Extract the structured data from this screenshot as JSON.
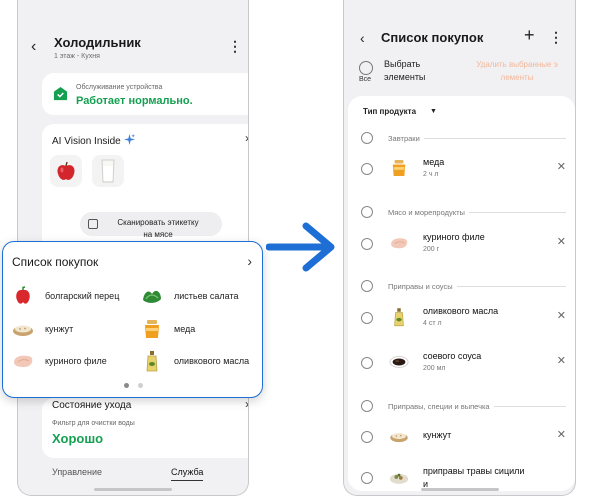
{
  "left": {
    "header": {
      "title": "Холодильник",
      "subtitle": "1 этаж - Кухня"
    },
    "status": {
      "caption": "Обслуживание устройства",
      "value": "Работает нормально."
    },
    "vision": {
      "title": "AI Vision Inside",
      "scan_line1": "Сканировать этикетку",
      "scan_line2": "на мясе"
    },
    "shopping": {
      "title": "Список покупок",
      "items": [
        {
          "label": "болгарский перец",
          "icon": "bell-pepper-icon"
        },
        {
          "label": "листьев салата",
          "icon": "lettuce-icon"
        },
        {
          "label": "кунжут",
          "icon": "sesame-icon"
        },
        {
          "label": "меда",
          "icon": "honey-icon"
        },
        {
          "label": "куриного филе",
          "icon": "chicken-fillet-icon"
        },
        {
          "label": "оливкового масла",
          "icon": "olive-oil-icon"
        }
      ],
      "page_count": 2,
      "active_page": 1
    },
    "care": {
      "title": "Состояние ухода",
      "caption": "Фильтр для очистки воды",
      "value": "Хорошо"
    },
    "tabs": {
      "manage": "Управление",
      "service": "Служба",
      "active": "service"
    }
  },
  "right": {
    "header": {
      "title": "Список покупок"
    },
    "toolbar": {
      "all_label": "Все",
      "select_line1": "Выбрать",
      "select_line2": "элементы",
      "delete_line1": "Удалить выбранные э",
      "delete_line2": "лементы"
    },
    "filter_label": "Тип продукта",
    "sections": [
      {
        "title": "Завтраки",
        "items": [
          {
            "name": "меда",
            "qty": "2 ч л",
            "icon": "honey-icon"
          }
        ]
      },
      {
        "title": "Мясо и морепродукты",
        "items": [
          {
            "name": "куриного филе",
            "qty": "200 г",
            "icon": "chicken-fillet-icon"
          }
        ]
      },
      {
        "title": "Приправы и соусы",
        "items": [
          {
            "name": "оливкового масла",
            "qty": "4 ст л",
            "icon": "olive-oil-icon"
          },
          {
            "name": "соевого соуса",
            "qty": "200 мл",
            "icon": "soy-sauce-icon"
          }
        ]
      },
      {
        "title": "Приправы, специи и выпечка",
        "items": [
          {
            "name": "кунжут",
            "qty": "",
            "icon": "sesame-icon"
          },
          {
            "name": "приправы травы сицили",
            "qty": "и",
            "icon": "herbs-icon"
          }
        ]
      }
    ]
  },
  "colors": {
    "accent_blue": "#1d6fd6",
    "status_green": "#14a050",
    "disabled_orange": "#f2b79a"
  }
}
